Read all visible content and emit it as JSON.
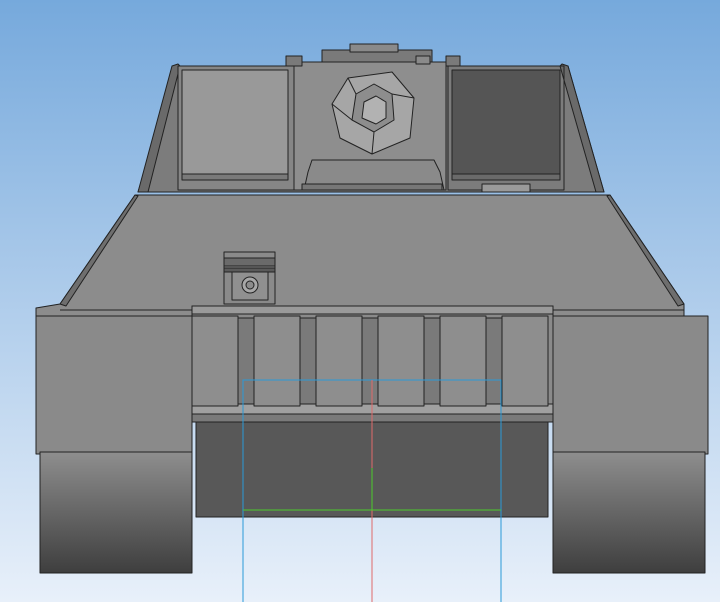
{
  "viewport": {
    "background_top_color": "#76a9dc",
    "background_bottom_color": "#e8f0fa"
  },
  "model": {
    "subject": "tank front view",
    "shading_color": "#8e8e8e",
    "edge_color": "#222222",
    "dark_face_color": "#555555"
  },
  "overlay": {
    "frame_color": "#2a9ad8",
    "axis_x_color": "#4ccc2c",
    "axis_y_color": "#e06a6a"
  }
}
